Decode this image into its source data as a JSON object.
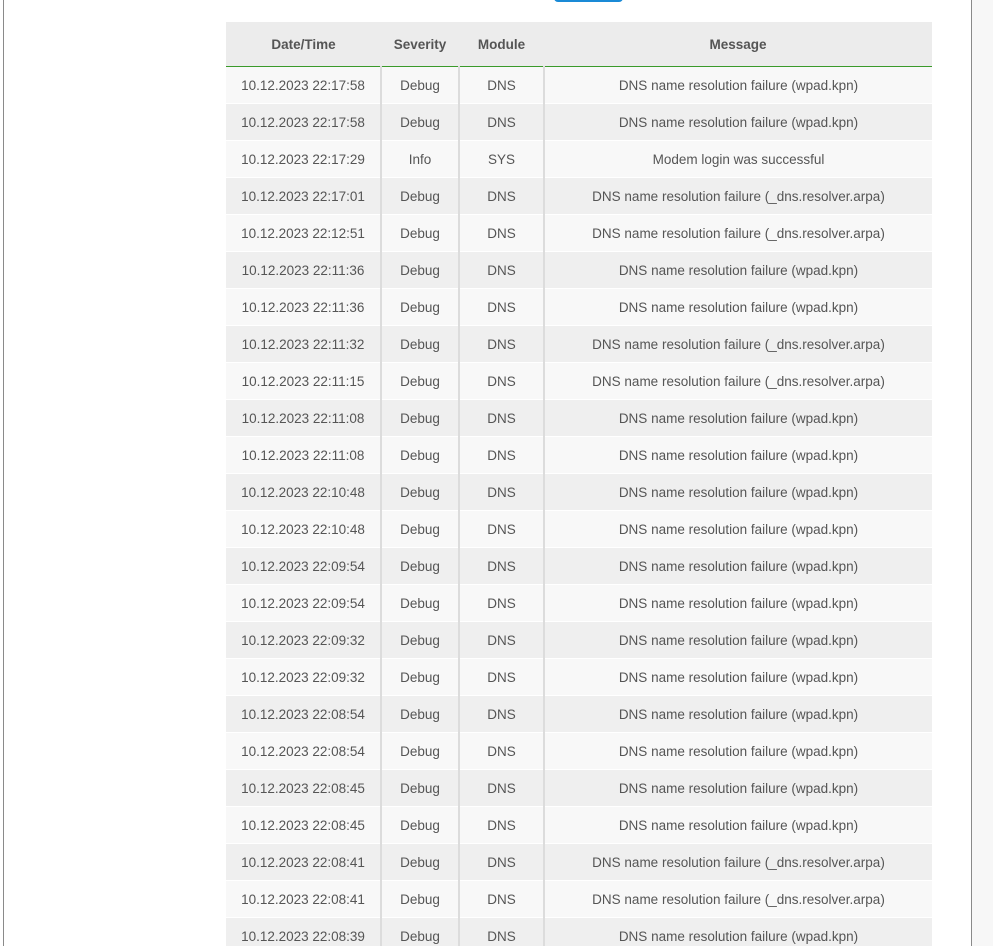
{
  "log_table": {
    "headers": {
      "datetime": "Date/Time",
      "severity": "Severity",
      "module": "Module",
      "message": "Message"
    },
    "rows": [
      {
        "datetime": "10.12.2023 22:17:58",
        "severity": "Debug",
        "module": "DNS",
        "message": "DNS name resolution failure (wpad.kpn)"
      },
      {
        "datetime": "10.12.2023 22:17:58",
        "severity": "Debug",
        "module": "DNS",
        "message": "DNS name resolution failure (wpad.kpn)"
      },
      {
        "datetime": "10.12.2023 22:17:29",
        "severity": "Info",
        "module": "SYS",
        "message": "Modem login was successful"
      },
      {
        "datetime": "10.12.2023 22:17:01",
        "severity": "Debug",
        "module": "DNS",
        "message": "DNS name resolution failure (_dns.resolver.arpa)"
      },
      {
        "datetime": "10.12.2023 22:12:51",
        "severity": "Debug",
        "module": "DNS",
        "message": "DNS name resolution failure (_dns.resolver.arpa)"
      },
      {
        "datetime": "10.12.2023 22:11:36",
        "severity": "Debug",
        "module": "DNS",
        "message": "DNS name resolution failure (wpad.kpn)"
      },
      {
        "datetime": "10.12.2023 22:11:36",
        "severity": "Debug",
        "module": "DNS",
        "message": "DNS name resolution failure (wpad.kpn)"
      },
      {
        "datetime": "10.12.2023 22:11:32",
        "severity": "Debug",
        "module": "DNS",
        "message": "DNS name resolution failure (_dns.resolver.arpa)"
      },
      {
        "datetime": "10.12.2023 22:11:15",
        "severity": "Debug",
        "module": "DNS",
        "message": "DNS name resolution failure (_dns.resolver.arpa)"
      },
      {
        "datetime": "10.12.2023 22:11:08",
        "severity": "Debug",
        "module": "DNS",
        "message": "DNS name resolution failure (wpad.kpn)"
      },
      {
        "datetime": "10.12.2023 22:11:08",
        "severity": "Debug",
        "module": "DNS",
        "message": "DNS name resolution failure (wpad.kpn)"
      },
      {
        "datetime": "10.12.2023 22:10:48",
        "severity": "Debug",
        "module": "DNS",
        "message": "DNS name resolution failure (wpad.kpn)"
      },
      {
        "datetime": "10.12.2023 22:10:48",
        "severity": "Debug",
        "module": "DNS",
        "message": "DNS name resolution failure (wpad.kpn)"
      },
      {
        "datetime": "10.12.2023 22:09:54",
        "severity": "Debug",
        "module": "DNS",
        "message": "DNS name resolution failure (wpad.kpn)"
      },
      {
        "datetime": "10.12.2023 22:09:54",
        "severity": "Debug",
        "module": "DNS",
        "message": "DNS name resolution failure (wpad.kpn)"
      },
      {
        "datetime": "10.12.2023 22:09:32",
        "severity": "Debug",
        "module": "DNS",
        "message": "DNS name resolution failure (wpad.kpn)"
      },
      {
        "datetime": "10.12.2023 22:09:32",
        "severity": "Debug",
        "module": "DNS",
        "message": "DNS name resolution failure (wpad.kpn)"
      },
      {
        "datetime": "10.12.2023 22:08:54",
        "severity": "Debug",
        "module": "DNS",
        "message": "DNS name resolution failure (wpad.kpn)"
      },
      {
        "datetime": "10.12.2023 22:08:54",
        "severity": "Debug",
        "module": "DNS",
        "message": "DNS name resolution failure (wpad.kpn)"
      },
      {
        "datetime": "10.12.2023 22:08:45",
        "severity": "Debug",
        "module": "DNS",
        "message": "DNS name resolution failure (wpad.kpn)"
      },
      {
        "datetime": "10.12.2023 22:08:45",
        "severity": "Debug",
        "module": "DNS",
        "message": "DNS name resolution failure (wpad.kpn)"
      },
      {
        "datetime": "10.12.2023 22:08:41",
        "severity": "Debug",
        "module": "DNS",
        "message": "DNS name resolution failure (_dns.resolver.arpa)"
      },
      {
        "datetime": "10.12.2023 22:08:41",
        "severity": "Debug",
        "module": "DNS",
        "message": "DNS name resolution failure (_dns.resolver.arpa)"
      },
      {
        "datetime": "10.12.2023 22:08:39",
        "severity": "Debug",
        "module": "DNS",
        "message": "DNS name resolution failure (wpad.kpn)"
      }
    ]
  },
  "colors": {
    "header_bg": "#ececec",
    "header_underline": "#3a9a2a",
    "row_odd": "#f8f8f8",
    "row_even": "#efefef",
    "text": "#555555",
    "top_button": "#1a8ad6"
  }
}
